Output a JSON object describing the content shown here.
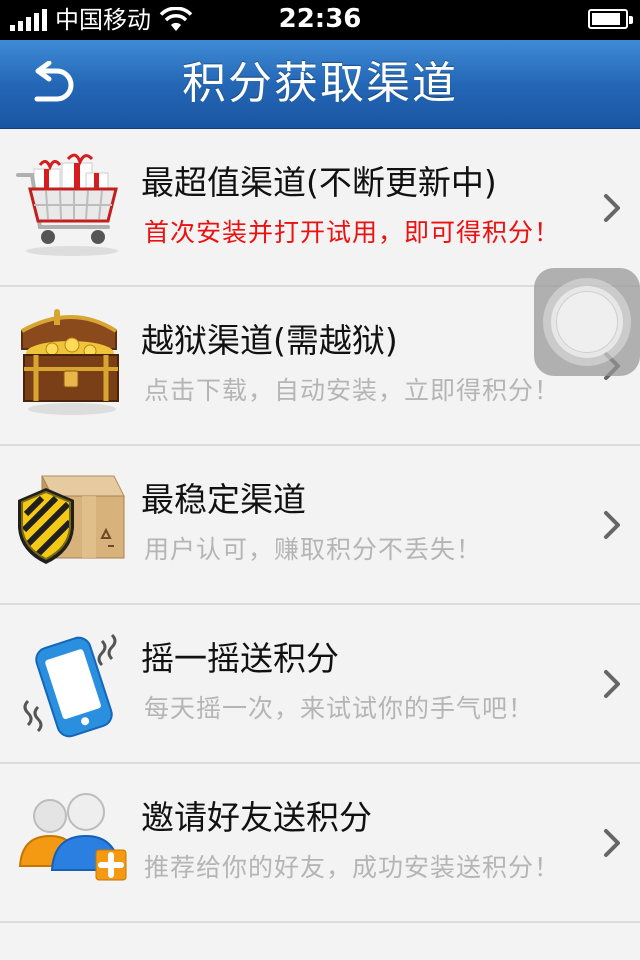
{
  "status_bar": {
    "carrier": "中国移动",
    "time": "22:36"
  },
  "nav": {
    "title": "积分获取渠道",
    "back_icon": "back-arrow-icon",
    "color": "#2467b6"
  },
  "items": [
    {
      "title": "最超值渠道(不断更新中)",
      "subtitle": "首次安装并打开试用，即可得积分！",
      "subtitle_color": "#ee0f0f",
      "icon": "shopping-cart-gifts-icon"
    },
    {
      "title": "越狱渠道(需越狱)",
      "subtitle": "点击下载，自动安装，立即得积分！",
      "icon": "treasure-chest-icon"
    },
    {
      "title": "最稳定渠道",
      "subtitle": "用户认可，赚取积分不丢失！",
      "icon": "shield-box-icon"
    },
    {
      "title": "摇一摇送积分",
      "subtitle": "每天摇一次，来试试你的手气吧！",
      "icon": "shaking-phone-icon"
    },
    {
      "title": "邀请好友送积分",
      "subtitle": "推荐给你的好友，成功安装送积分！",
      "icon": "add-friends-icon"
    }
  ]
}
